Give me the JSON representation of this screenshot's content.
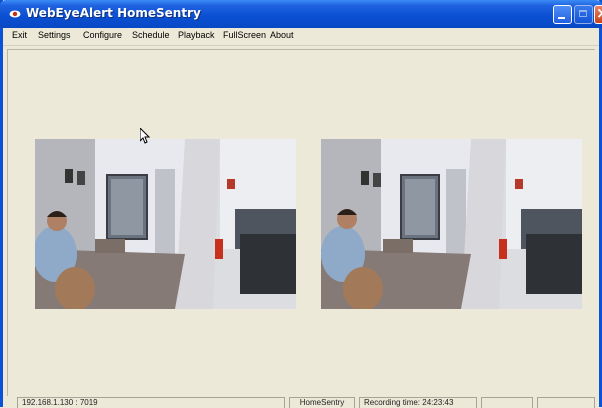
{
  "window": {
    "title": "WebEyeAlert HomeSentry"
  },
  "menu": {
    "items": [
      "Exit",
      "Settings",
      "Configure",
      "Schedule",
      "Playback",
      "FullScreen",
      "About"
    ]
  },
  "cameras": [
    {
      "icon": "camera-feed-office"
    },
    {
      "icon": "camera-feed-office"
    }
  ],
  "status": {
    "address": "192.168.1.130 : 7019",
    "app_name": "HomeSentry",
    "recording": "Recording time: 24:23:43",
    "empty1": "",
    "empty2": ""
  },
  "colors": {
    "titlebar": "#0a4fd2",
    "window_bg": "#ece9d8"
  }
}
